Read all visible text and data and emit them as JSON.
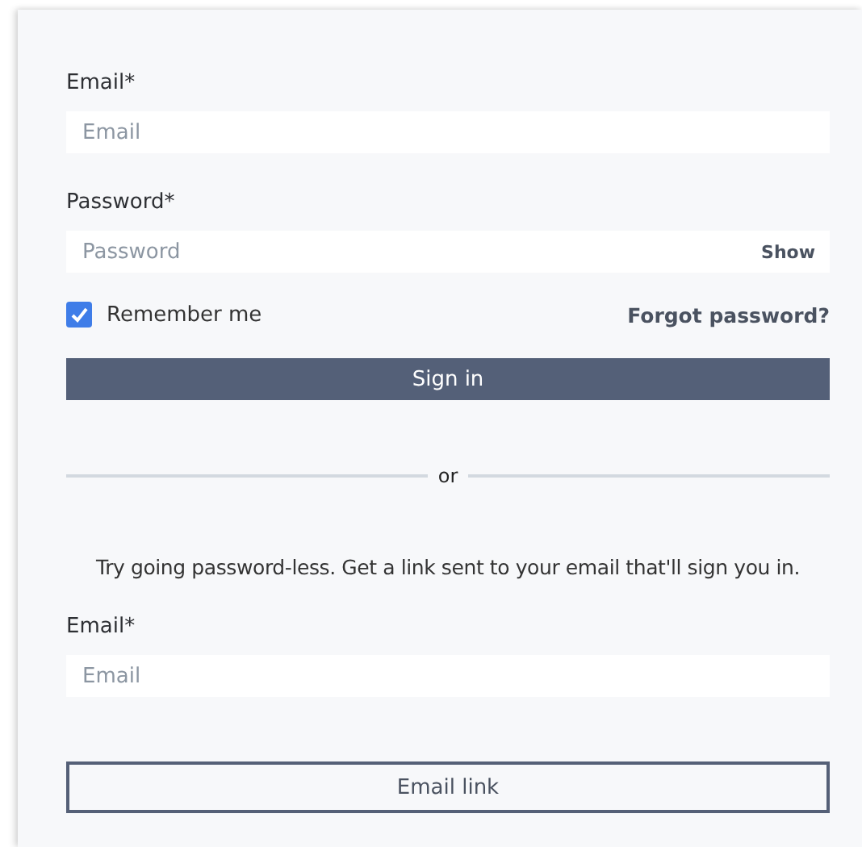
{
  "sign_in": {
    "email": {
      "label": "Email*",
      "placeholder": "Email"
    },
    "password": {
      "label": "Password*",
      "placeholder": "Password",
      "toggle": "Show"
    },
    "remember": {
      "label": "Remember me",
      "checked": true
    },
    "forgot_link": "Forgot password?",
    "submit": "Sign in"
  },
  "divider": "or",
  "passwordless": {
    "message": "Try going password-less. Get a link sent to your email that'll sign you in.",
    "email": {
      "label": "Email*",
      "placeholder": "Email"
    },
    "submit": "Email link"
  }
}
